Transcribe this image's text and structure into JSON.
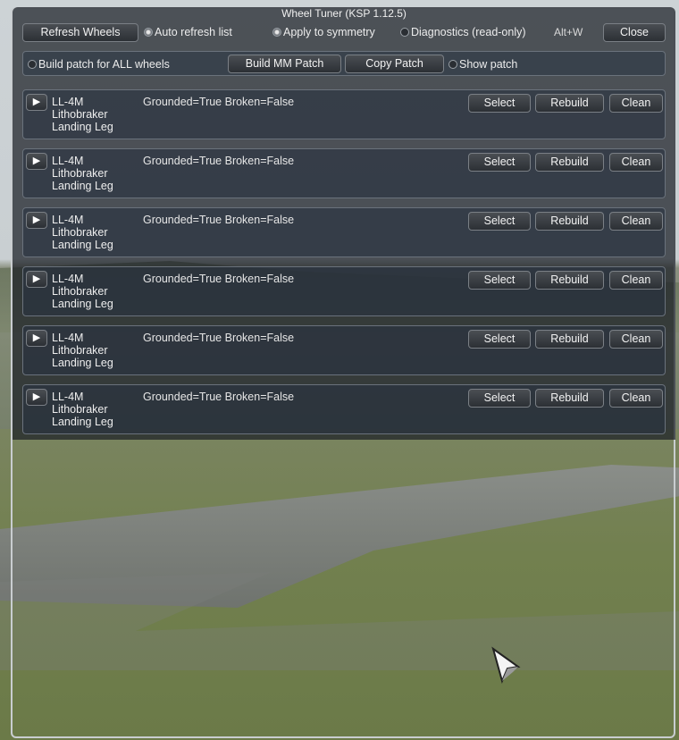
{
  "window": {
    "title": "Wheel Tuner (KSP 1.12.5)",
    "shortcut": "Alt+W"
  },
  "toolbar": {
    "refresh_label": "Refresh Wheels",
    "auto_refresh_label": "Auto refresh list",
    "auto_refresh_checked": true,
    "symmetry_label": "Apply to symmetry",
    "symmetry_checked": true,
    "diagnostics_label": "Diagnostics (read-only)",
    "diagnostics_checked": false,
    "close_label": "Close"
  },
  "patch": {
    "all_wheels_label": "Build patch for ALL wheels",
    "all_wheels_checked": false,
    "build_label": "Build MM Patch",
    "copy_label": "Copy Patch",
    "show_label": "Show patch",
    "show_checked": false
  },
  "wheels": [
    {
      "expand": "▶",
      "name_l1": "LL-4M",
      "name_l2": "Lithobraker",
      "name_l3": "Landing Leg",
      "status": "Grounded=True Broken=False",
      "select": "Select",
      "rebuild": "Rebuild",
      "clean": "Clean"
    },
    {
      "expand": "▶",
      "name_l1": "LL-4M",
      "name_l2": "Lithobraker",
      "name_l3": "Landing Leg",
      "status": "Grounded=True Broken=False",
      "select": "Select",
      "rebuild": "Rebuild",
      "clean": "Clean"
    },
    {
      "expand": "▶",
      "name_l1": "LL-4M",
      "name_l2": "Lithobraker",
      "name_l3": "Landing Leg",
      "status": "Grounded=True Broken=False",
      "select": "Select",
      "rebuild": "Rebuild",
      "clean": "Clean"
    },
    {
      "expand": "▶",
      "name_l1": "LL-4M",
      "name_l2": "Lithobraker",
      "name_l3": "Landing Leg",
      "status": "Grounded=True Broken=False",
      "select": "Select",
      "rebuild": "Rebuild",
      "clean": "Clean"
    },
    {
      "expand": "▶",
      "name_l1": "LL-4M",
      "name_l2": "Lithobraker",
      "name_l3": "Landing Leg",
      "status": "Grounded=True Broken=False",
      "select": "Select",
      "rebuild": "Rebuild",
      "clean": "Clean"
    },
    {
      "expand": "▶",
      "name_l1": "LL-4M",
      "name_l2": "Lithobraker",
      "name_l3": "Landing Leg",
      "status": "Grounded=True Broken=False",
      "select": "Select",
      "rebuild": "Rebuild",
      "clean": "Clean"
    }
  ]
}
